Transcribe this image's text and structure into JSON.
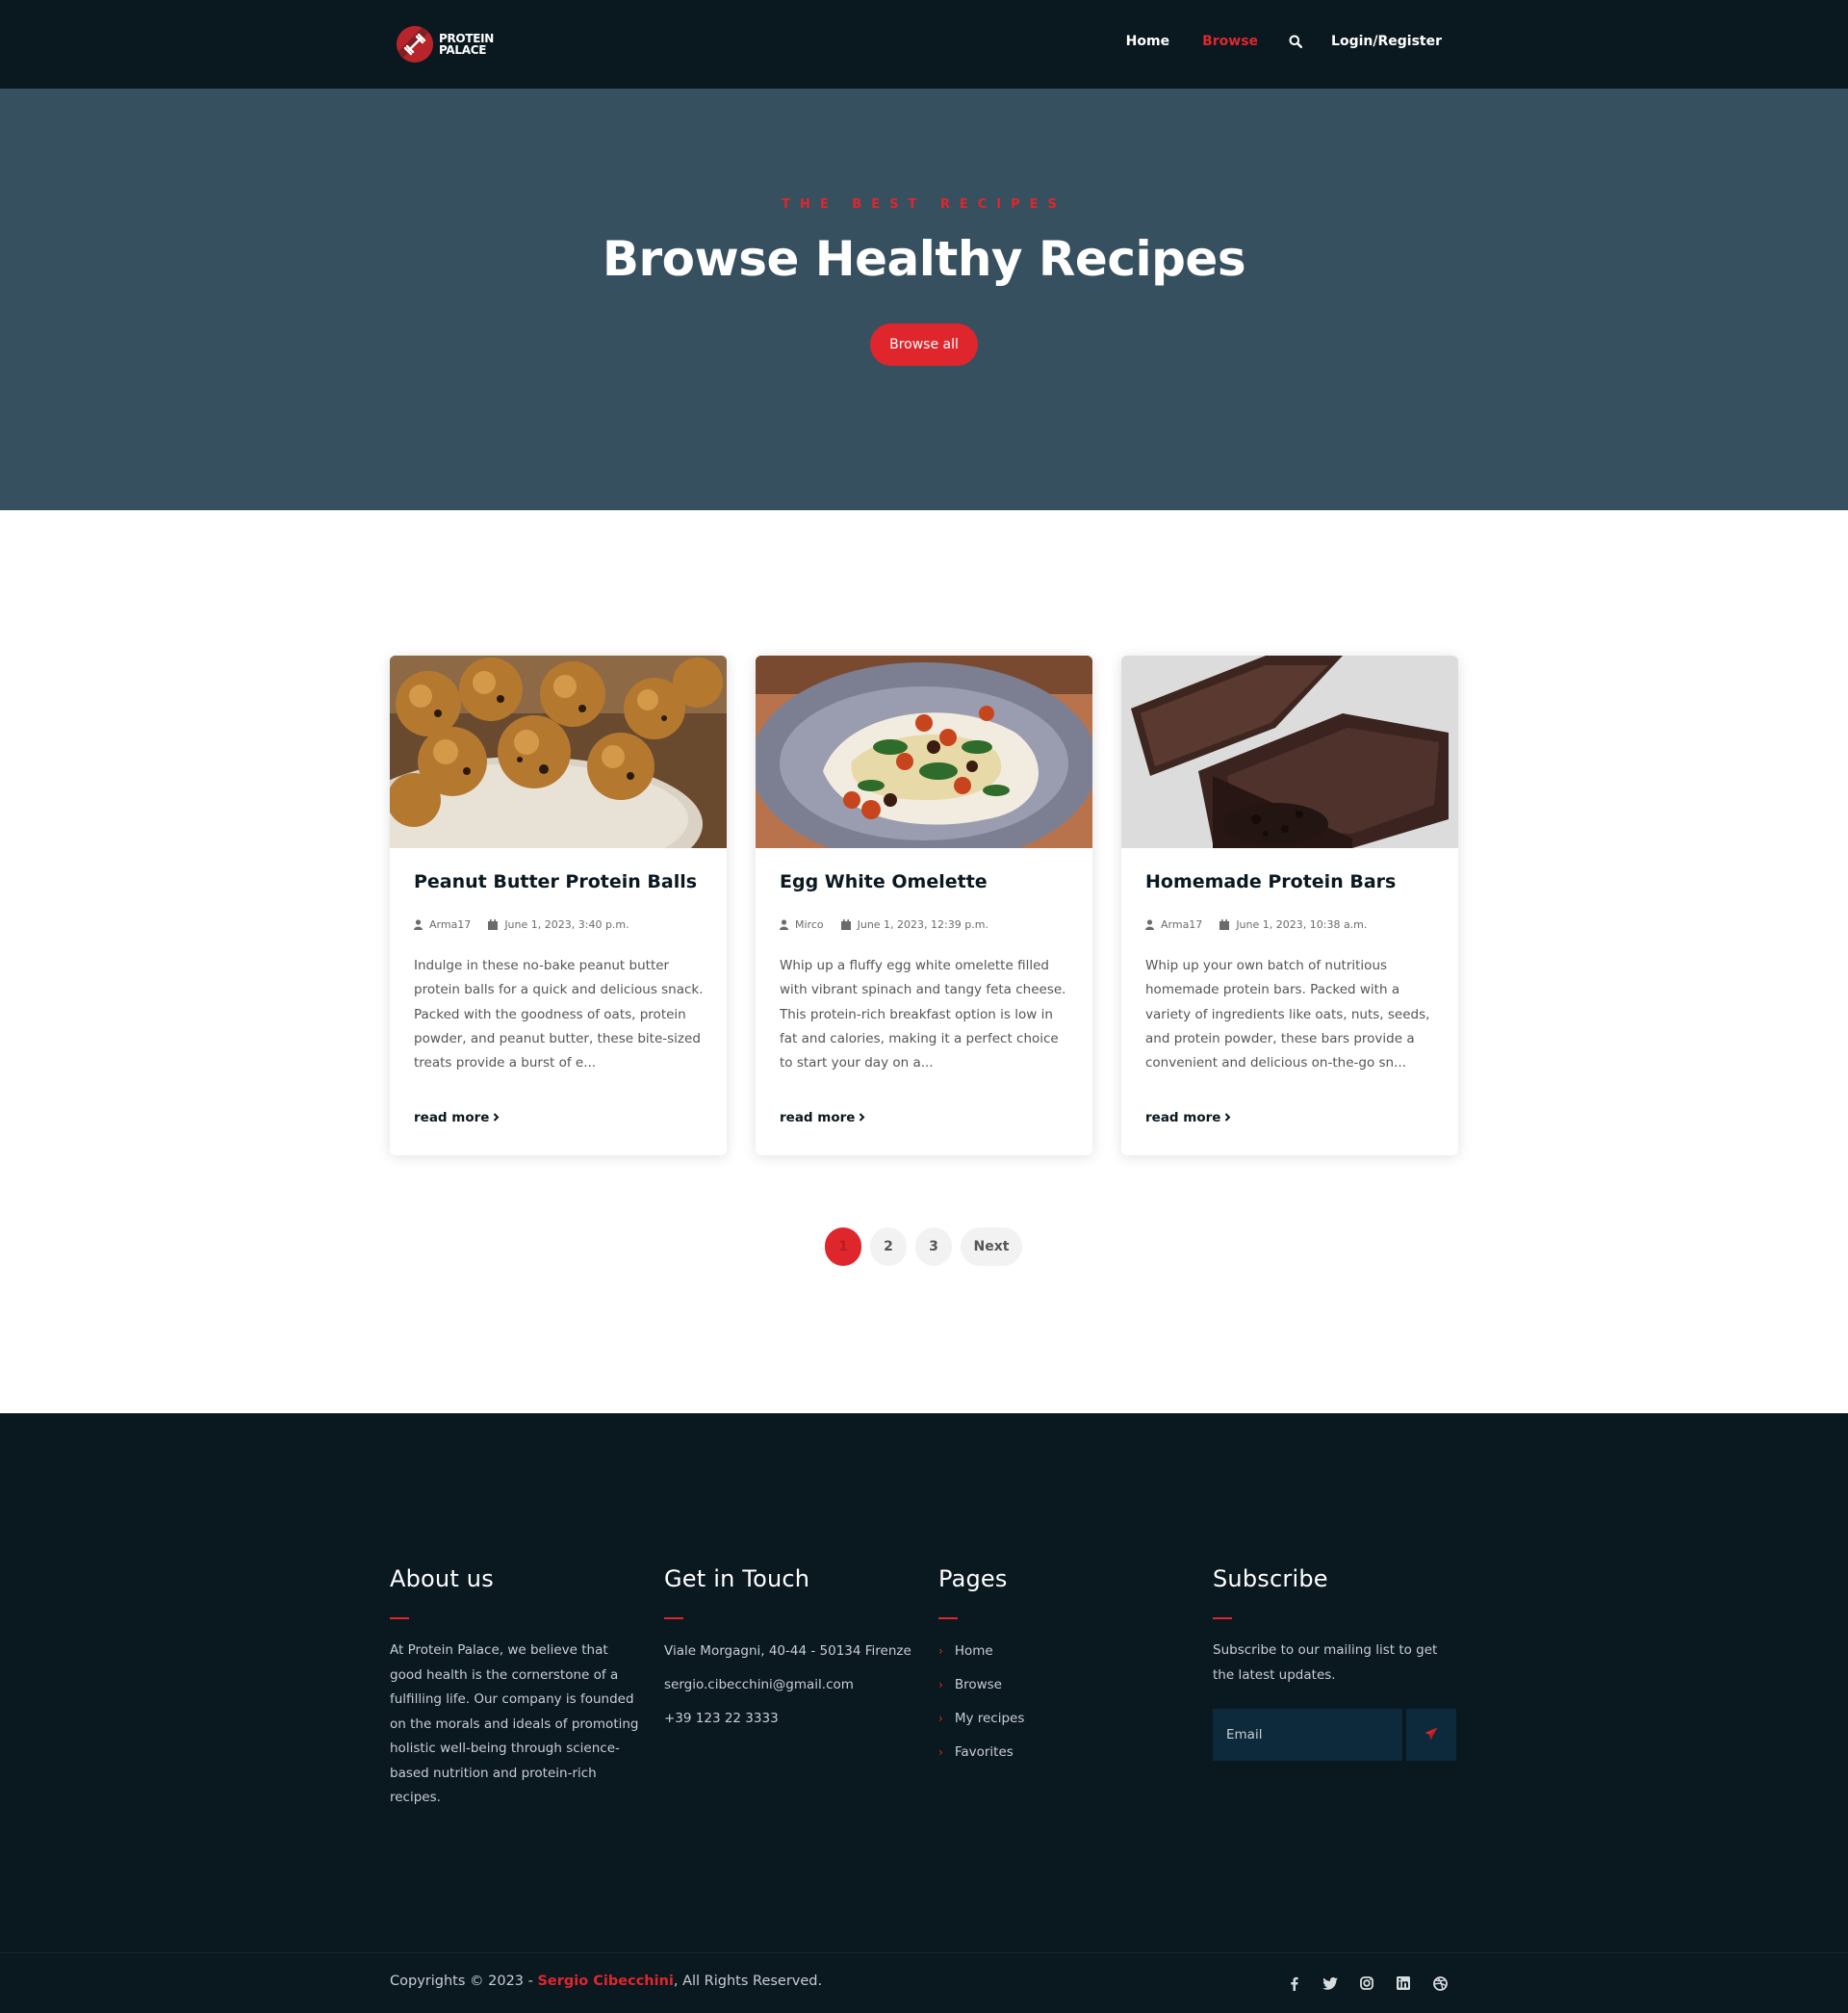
{
  "header": {
    "logo_line1": "PROTEIN",
    "logo_line2": "PALACE",
    "nav": {
      "home": "Home",
      "browse": "Browse",
      "login": "Login/Register"
    }
  },
  "hero": {
    "eyebrow": "THE BEST RECIPES",
    "title": "Browse Healthy Recipes",
    "button": "Browse all"
  },
  "cards": [
    {
      "title": "Peanut Butter Protein Balls",
      "author": "Arma17",
      "date": "June 1, 2023, 3:40 p.m.",
      "description": "Indulge in these no-bake peanut butter protein balls for a quick and delicious snack. Packed with the goodness of oats, protein powder, and peanut butter, these bite-sized treats provide a burst of e...",
      "more": "read more"
    },
    {
      "title": "Egg White Omelette",
      "author": "Mirco",
      "date": "June 1, 2023, 12:39 p.m.",
      "description": "Whip up a fluffy egg white omelette filled with vibrant spinach and tangy feta cheese. This protein-rich breakfast option is low in fat and calories, making it a perfect choice to start your day on a...",
      "more": "read more"
    },
    {
      "title": "Homemade Protein Bars",
      "author": "Arma17",
      "date": "June 1, 2023, 10:38 a.m.",
      "description": "Whip up your own batch of nutritious homemade protein bars. Packed with a variety of ingredients like oats, nuts, seeds, and protein powder, these bars provide a convenient and delicious on-the-go sn...",
      "more": "read more"
    }
  ],
  "pagination": {
    "pages": [
      "1",
      "2",
      "3"
    ],
    "active": "1",
    "next": "Next"
  },
  "footer": {
    "about": {
      "heading": "About us",
      "text": "At Protein Palace, we believe that good health is the cornerstone of a fulfilling life. Our company is founded on the morals and ideals of promoting holistic well-being through science-based nutrition and protein-rich recipes."
    },
    "contact": {
      "heading": "Get in Touch",
      "address": "Viale Morgagni, 40-44 - 50134 Firenze",
      "email": "sergio.cibecchini@gmail.com",
      "phone": "+39 123 22 3333"
    },
    "pages": {
      "heading": "Pages",
      "links": [
        "Home",
        "Browse",
        "My recipes",
        "Favorites"
      ]
    },
    "subscribe": {
      "heading": "Subscribe",
      "text": "Subscribe to our mailing list to get the latest updates.",
      "placeholder": "Email"
    },
    "copyright_prefix": "Copyrights © 2023 - ",
    "copyright_name": "Sergio Cibecchini",
    "copyright_suffix": ", All Rights Reserved.",
    "social": [
      "facebook-icon",
      "twitter-icon",
      "instagram-icon",
      "linkedin-icon",
      "dribbble-icon"
    ]
  },
  "colors": {
    "accent": "#e0262d",
    "header_bg": "#0a1820",
    "hero_bg": "#37505f",
    "footer_bg": "#0a1820"
  }
}
